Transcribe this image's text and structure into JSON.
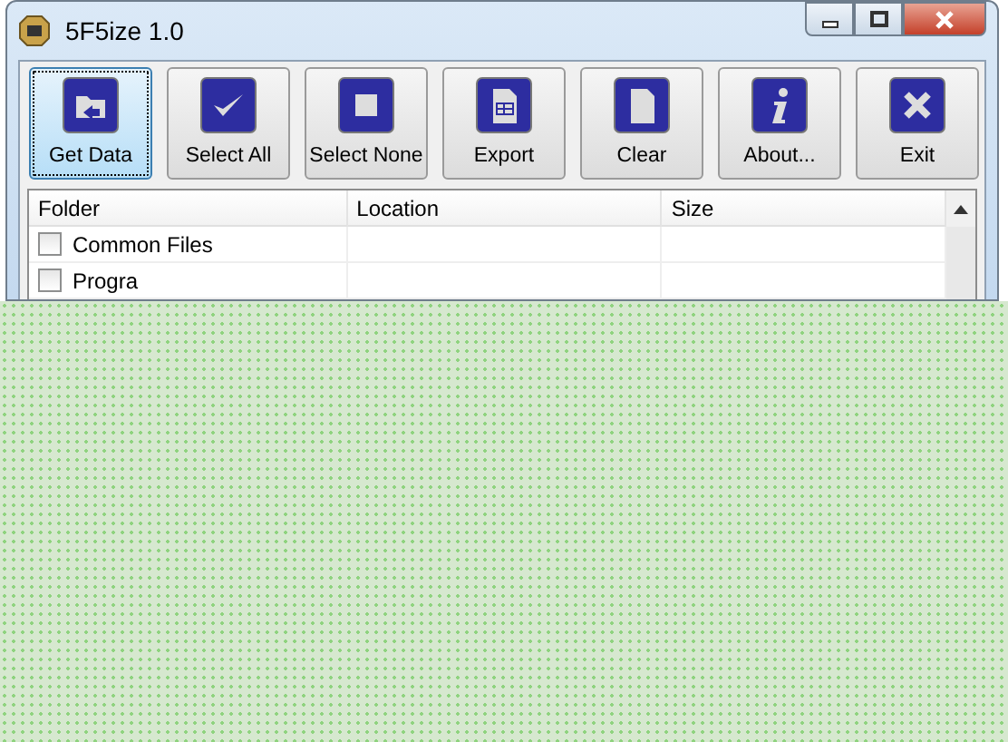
{
  "window": {
    "title": "5F5ize 1.0"
  },
  "toolbar": [
    {
      "label": "Get Data",
      "kind": "folder",
      "selected": true
    },
    {
      "label": "Select All",
      "kind": "check",
      "selected": false
    },
    {
      "label": "Select None",
      "kind": "square",
      "selected": false
    },
    {
      "label": "Export",
      "kind": "sheet",
      "selected": false
    },
    {
      "label": "Clear",
      "kind": "page",
      "selected": false
    },
    {
      "label": "About...",
      "kind": "info",
      "selected": false
    },
    {
      "label": "Exit",
      "kind": "x",
      "selected": false
    }
  ],
  "table": {
    "columns": [
      "Folder",
      "Location",
      "Size"
    ],
    "rows": [
      {
        "folder": "Common Files",
        "checked": false
      },
      {
        "folder": "Progra",
        "checked": false
      }
    ]
  }
}
